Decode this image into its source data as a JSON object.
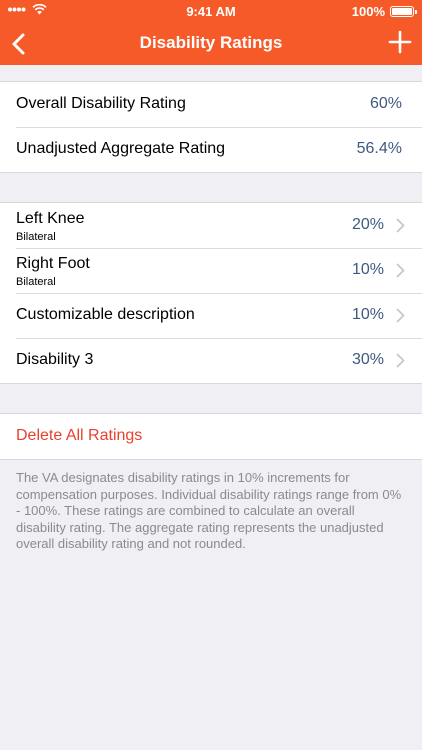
{
  "status": {
    "time": "9:41 AM",
    "battery": "100%"
  },
  "nav": {
    "title": "Disability Ratings",
    "back_icon": "chevron-left-icon",
    "add_icon": "plus-icon"
  },
  "summary": [
    {
      "label": "Overall Disability Rating",
      "value": "60%"
    },
    {
      "label": "Unadjusted Aggregate Rating",
      "value": "56.4%"
    }
  ],
  "ratings": [
    {
      "label": "Left Knee",
      "sub": "Bilateral",
      "value": "20%"
    },
    {
      "label": "Right Foot",
      "sub": "Bilateral",
      "value": "10%"
    },
    {
      "label": "Customizable description",
      "value": "10%"
    },
    {
      "label": "Disability 3",
      "value": "30%"
    }
  ],
  "actions": {
    "delete_all": "Delete All Ratings"
  },
  "footnote": "The VA designates disability ratings in 10% increments for compensation purposes. Individual disability ratings range from 0% - 100%. These ratings are combined to calculate an overall disability rating. The aggregate rating represents the unadjusted overall disability rating and not rounded.",
  "colors": {
    "accent": "#f65a28",
    "value_text": "#3d5a80",
    "danger": "#e8412f",
    "background": "#efeff4"
  }
}
